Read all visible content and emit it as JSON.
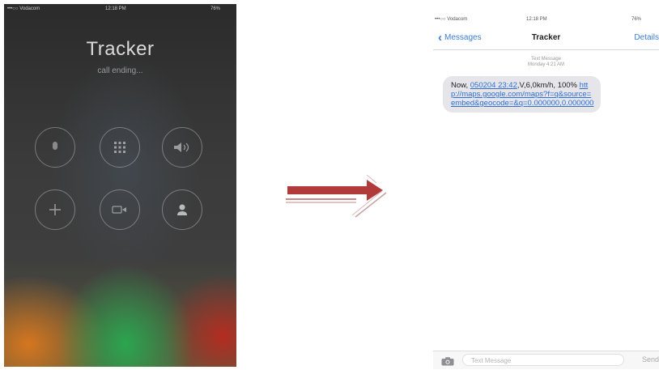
{
  "call_screen": {
    "status": {
      "carrier": "•••○○ Vodacom",
      "time": "12:18 PM",
      "battery": "76%"
    },
    "title": "Tracker",
    "subtitle": "call ending..."
  },
  "messages_screen": {
    "status": {
      "carrier": "•••○○ Vodacom",
      "time": "12:18 PM",
      "battery": "76%"
    },
    "back_label": "Messages",
    "title": "Tracker",
    "details_label": "Details",
    "meta": {
      "type": "Text Message",
      "date": "Monday 4:21 AM"
    },
    "message": {
      "prefix": "Now, ",
      "datetime_link": "050204 23:42",
      "suffix": ",V,6,0km/h, 100%",
      "url_link": "http://maps.google.com/maps?f=q&source=embed&geocode=&q=0.000000,0.000000"
    },
    "input": {
      "placeholder": "Text Message",
      "send_label": "Send"
    }
  },
  "colors": {
    "ios_blue": "#3b7bd6",
    "arrow": "#b13a3a",
    "bubble": "#e6e6ea"
  }
}
